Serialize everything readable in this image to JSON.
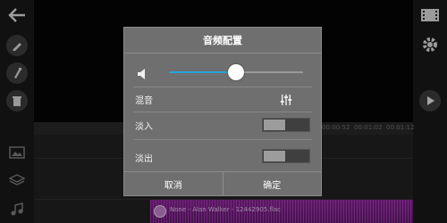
{
  "dialog": {
    "title": "音频配置",
    "volume_level": 0.5,
    "mix_label": "混音",
    "fade_in_label": "淡入",
    "fade_out_label": "淡出",
    "fade_in_on": false,
    "fade_out_on": false,
    "cancel_label": "取消",
    "confirm_label": "确定"
  },
  "timeline": {
    "ruler_labels": [
      "00:00:52",
      "00:01:02",
      "00:01:12"
    ],
    "clip_label": "None - Alan Walker - 12442905.flac"
  },
  "left_tools": [
    "back-arrow-icon",
    "pencil-icon",
    "brush-icon",
    "trash-icon",
    "image-icon",
    "layers-icon",
    "music-icon"
  ],
  "right_tools": [
    "film-icon",
    "gear-icon",
    "play-icon"
  ],
  "colors": {
    "accent": "#26a5d9",
    "clip": "#6e1c7a",
    "dialog": "#6f6f6f"
  }
}
